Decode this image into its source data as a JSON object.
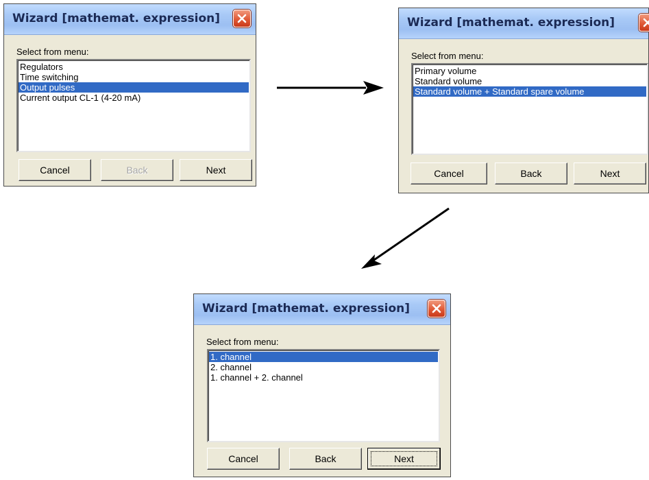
{
  "colors": {
    "dialog_bg": "#ece9d8",
    "titlebar": "#a8c9f6",
    "close_button": "#e05a37",
    "selection": "#316ac5"
  },
  "dialogs": [
    {
      "title": "Wizard [mathemat. expression]",
      "prompt": "Select from menu:",
      "items": [
        "Regulators",
        "Time switching",
        "Output pulses",
        "Current output CL-1 (4-20 mA)"
      ],
      "selected_item": "Output pulses",
      "buttons": {
        "cancel": "Cancel",
        "back": "Back",
        "next": "Next"
      },
      "back_enabled": false
    },
    {
      "title": "Wizard [mathemat. expression]",
      "prompt": "Select from menu:",
      "items": [
        "Primary volume",
        "Standard volume",
        "Standard volume + Standard spare volume"
      ],
      "selected_item": "Standard volume + Standard spare volume",
      "buttons": {
        "cancel": "Cancel",
        "back": "Back",
        "next": "Next"
      },
      "back_enabled": true
    },
    {
      "title": "Wizard [mathemat. expression]",
      "prompt": "Select from menu:",
      "items": [
        "1. channel",
        "2. channel",
        "1. channel + 2. channel"
      ],
      "selected_item": "1. channel",
      "buttons": {
        "cancel": "Cancel",
        "back": "Back",
        "next": "Next"
      },
      "back_enabled": true,
      "focused_button": "next"
    }
  ],
  "icons": {
    "close": "close-icon",
    "arrow": "arrow-icon"
  }
}
